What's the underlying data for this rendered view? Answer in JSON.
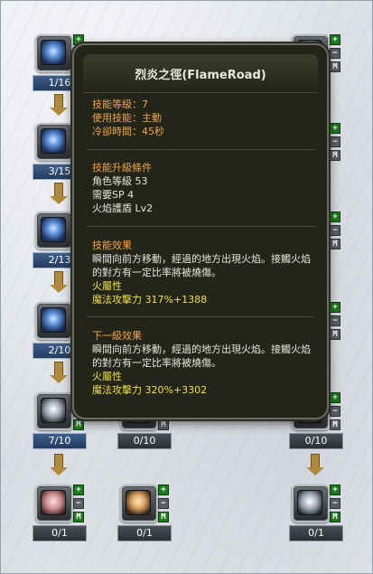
{
  "skills": [
    {
      "level": "1/16",
      "icon": "water-drop-skill-icon"
    },
    {
      "level": "3/15",
      "icon": "blue-flame-skill-icon"
    },
    {
      "level": "2/13",
      "icon": "blue-fire-skill-icon"
    },
    {
      "level": "2/10",
      "icon": "blue-orb-skill-icon"
    },
    {
      "level": "7/10",
      "icon": "wind-spiral-skill-icon"
    },
    {
      "level": "0/10",
      "icon": "hidden-skill-icon"
    },
    {
      "level": "0/10",
      "icon": "hidden-skill-icon"
    },
    {
      "level": "0/1",
      "icon": "pink-aura-skill-icon"
    },
    {
      "level": "0/1",
      "icon": "sun-rune-skill-icon"
    },
    {
      "level": "0/1",
      "icon": "silver-shield-skill-icon"
    }
  ],
  "buttons": {
    "plus": "+",
    "minus": "−",
    "max": "M"
  },
  "tooltip": {
    "title": "烈炎之徑(FlameRoad)",
    "skill_level": "技能等級：7",
    "usage": "使用技能：主動",
    "cooldown": "冷卻時間：45秒",
    "upgrade_header": "技能升級條件",
    "req_char_level": "角色等級 53",
    "req_sp": "需要SP 4",
    "req_prereq": "火焰護盾 Lv2",
    "effect_header": "技能效果",
    "effect_desc": "瞬間向前方移動，經過的地方出現火焰。接觸火焰的對方有一定比率將被燒傷。",
    "effect_attr": "火屬性",
    "effect_power": "魔法攻擊力 317%+1388",
    "next_header": "下一級效果",
    "next_desc": "瞬間向前方移動，經過的地方出現火焰。接觸火焰的對方有一定比率將被燒傷。",
    "next_attr": "火屬性",
    "next_power": "魔法攻擊力 320%+3302"
  },
  "colors": {
    "orange": "#f0a64a",
    "yellow": "#f2df4a",
    "plus_green": "#1d7a1d"
  }
}
